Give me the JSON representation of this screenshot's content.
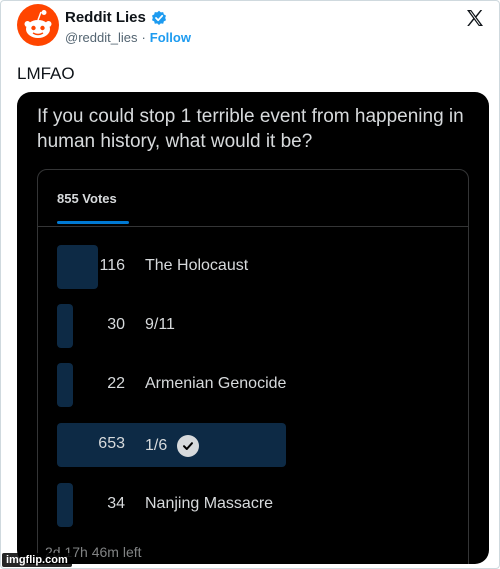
{
  "tweet": {
    "display_name": "Reddit Lies",
    "handle": "@reddit_lies",
    "separator": "·",
    "follow_label": "Follow",
    "text": "LMFAO"
  },
  "poll": {
    "question": "If you could stop 1 terrible event from happening in human history, what would it be?",
    "votes_label": "855 Votes",
    "time_left": "2d 17h 46m left",
    "total_votes": 855,
    "options": [
      {
        "count": "116",
        "label": "The Holocaust",
        "votes": 116,
        "selected": false
      },
      {
        "count": "30",
        "label": "9/11",
        "votes": 30,
        "selected": false
      },
      {
        "count": "22",
        "label": "Armenian Genocide",
        "votes": 22,
        "selected": false
      },
      {
        "count": "653",
        "label": "1/6",
        "votes": 653,
        "selected": true
      },
      {
        "count": "34",
        "label": "Nanjing Massacre",
        "votes": 34,
        "selected": false
      }
    ]
  },
  "watermark": "imgflip.com",
  "icons": {
    "avatar": "reddit-snoo-icon",
    "verified": "verified-badge-icon",
    "platform": "x-logo-icon",
    "selected_option": "check-icon"
  },
  "colors": {
    "avatar_bg": "#ff4500",
    "verified": "#1d9bf0",
    "follow": "#1d9bf0",
    "poll_bar": "#0d2a45",
    "votes_underline": "#0079d3"
  }
}
